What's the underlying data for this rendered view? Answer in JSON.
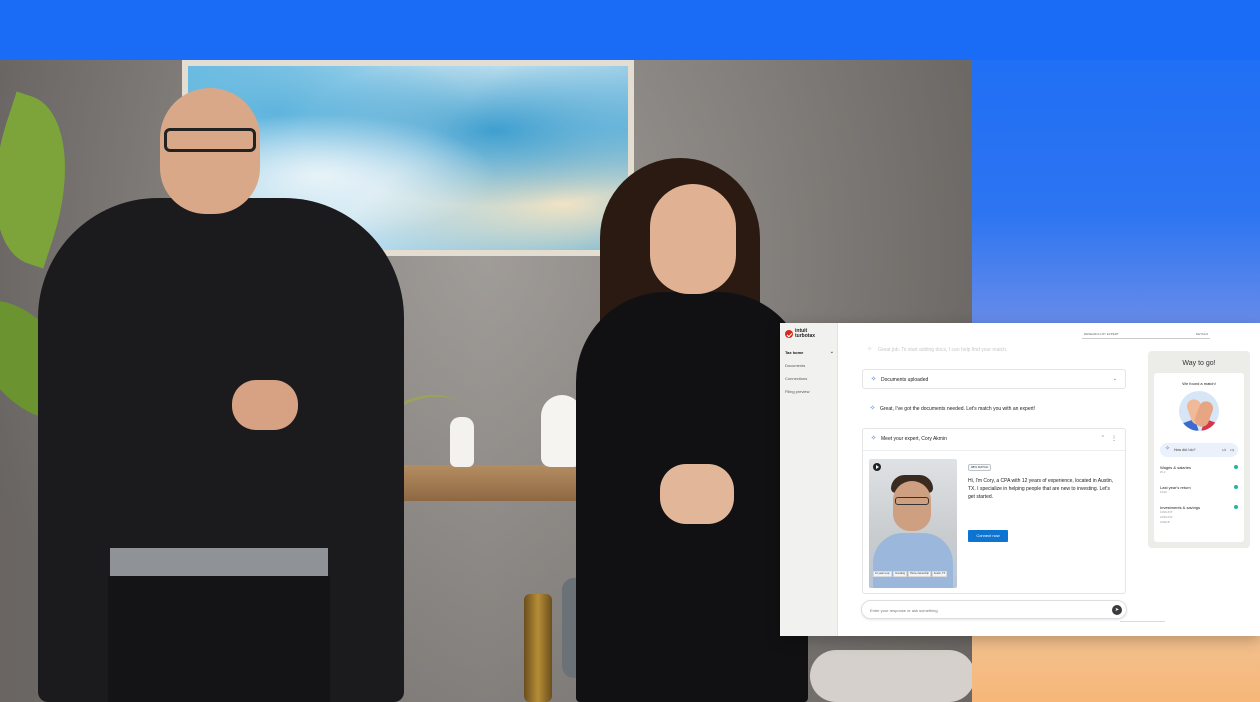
{
  "app": {
    "logo": {
      "line1": "intuit",
      "line2": "turbotax"
    },
    "topbar": {
      "left_label": "RESEARCH MY EXPERT",
      "right_label": "DETAILS"
    },
    "nav": [
      {
        "label": "Tax home",
        "active": true
      },
      {
        "label": "Documents",
        "active": false
      },
      {
        "label": "Connections",
        "active": false
      },
      {
        "label": "Filing preview",
        "active": false
      }
    ],
    "chat": {
      "faded_message": "Great job. To start adding docs, I can help find your match.",
      "documents_card": "Documents uploaded",
      "great_message": "Great, I've got the documents needed. Let's match you with an expert!",
      "expert_card": {
        "title": "Meet your expert, Cory Akmin",
        "match_badge": "98% MATCH",
        "bio": "Hi, I'm Cory, a CPA with 12 years of experience, located in Austin, TX. I specialize in helping people that are new to investing. Let's get started.",
        "connect_label": "Connect now",
        "video_tags": [
          "12 years exp.",
          "Investing",
          "Home ownership",
          "Austin, TX"
        ]
      },
      "input_placeholder": "Enter your response or ask something"
    },
    "progress": {
      "title": "Way to go!",
      "found_title": "We found a match!",
      "how_label": "How did I do?",
      "items": [
        {
          "label": "Wages & salaries",
          "sub": "W-2"
        },
        {
          "label": "Last year's return",
          "sub": "1040"
        },
        {
          "label": "Investments & savings",
          "sub": "1099-INT",
          "extra": [
            "1099-DIV",
            "1099-B"
          ]
        }
      ]
    }
  },
  "colors": {
    "accent": "#0d74d1",
    "brand_red": "#d52b1e",
    "band_blue": "#1a6bf6",
    "success": "#27b59a"
  }
}
